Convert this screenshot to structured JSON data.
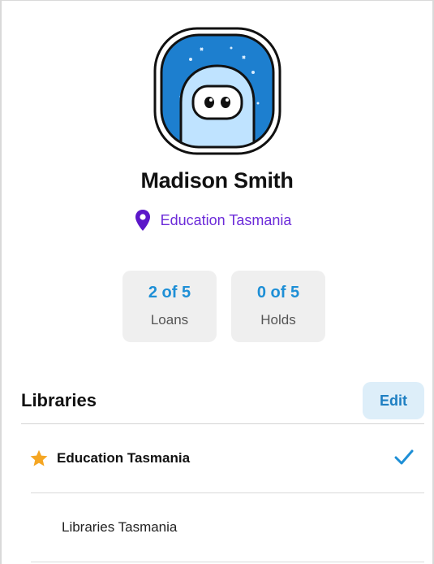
{
  "profile": {
    "name": "Madison Smith",
    "location": "Education Tasmania"
  },
  "stats": [
    {
      "value": "2 of 5",
      "label": "Loans"
    },
    {
      "value": "0 of 5",
      "label": "Holds"
    }
  ],
  "libraries": {
    "title": "Libraries",
    "edit_label": "Edit",
    "items": [
      {
        "name": "Education Tasmania",
        "favorite": true,
        "selected": true
      },
      {
        "name": "Libraries Tasmania",
        "favorite": false,
        "selected": false
      }
    ]
  },
  "colors": {
    "accent_blue": "#1e8fd6",
    "location_purple": "#6c2bd9",
    "star_orange": "#f5a623"
  },
  "icons": {
    "avatar": "robot-avatar",
    "location": "map-pin-icon",
    "favorite": "star-icon",
    "selected": "checkmark-icon"
  }
}
